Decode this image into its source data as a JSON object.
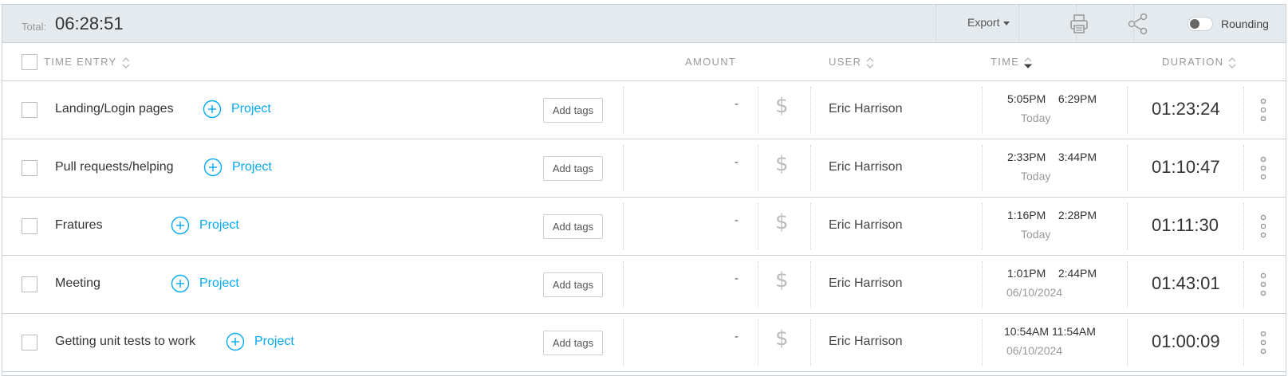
{
  "summary": {
    "total_label": "Total:",
    "total_value": "06:28:51",
    "export_label": "Export",
    "rounding_label": "Rounding",
    "rounding_enabled": false
  },
  "columns": {
    "time_entry": "TIME ENTRY",
    "amount": "AMOUNT",
    "user": "USER",
    "time": "TIME",
    "duration": "DURATION"
  },
  "colors": {
    "accent": "#03a9f4",
    "header_bg": "#e4eaee",
    "border": "#c8d0d6"
  },
  "icons": {
    "printer": "printer-icon",
    "share": "share-icon",
    "plus": "plus-circle-icon",
    "dollar": "dollar-icon",
    "more": "more-vertical-icon"
  },
  "entries": [
    {
      "description": "Landing/Login pages",
      "project": "Project",
      "tags": "Add tags",
      "amount": "-",
      "user": "Eric Harrison",
      "start": "5:05PM",
      "end": "6:29PM",
      "date": "Today",
      "duration": "01:23:24"
    },
    {
      "description": "Pull requests/helping",
      "project": "Project",
      "tags": "Add tags",
      "amount": "-",
      "user": "Eric Harrison",
      "start": "2:33PM",
      "end": "3:44PM",
      "date": "Today",
      "duration": "01:10:47"
    },
    {
      "description": "Fratures",
      "project": "Project",
      "tags": "Add tags",
      "amount": "-",
      "user": "Eric Harrison",
      "start": "1:16PM",
      "end": "2:28PM",
      "date": "Today",
      "duration": "01:11:30"
    },
    {
      "description": "Meeting",
      "project": "Project",
      "tags": "Add tags",
      "amount": "-",
      "user": "Eric Harrison",
      "start": "1:01PM",
      "end": "2:44PM",
      "date": "06/10/2024",
      "duration": "01:43:01"
    },
    {
      "description": "Getting unit tests to work",
      "project": "Project",
      "tags": "Add tags",
      "amount": "-",
      "user": "Eric Harrison",
      "start": "10:54AM",
      "end": "11:54AM",
      "date": "06/10/2024",
      "duration": "01:00:09"
    }
  ]
}
